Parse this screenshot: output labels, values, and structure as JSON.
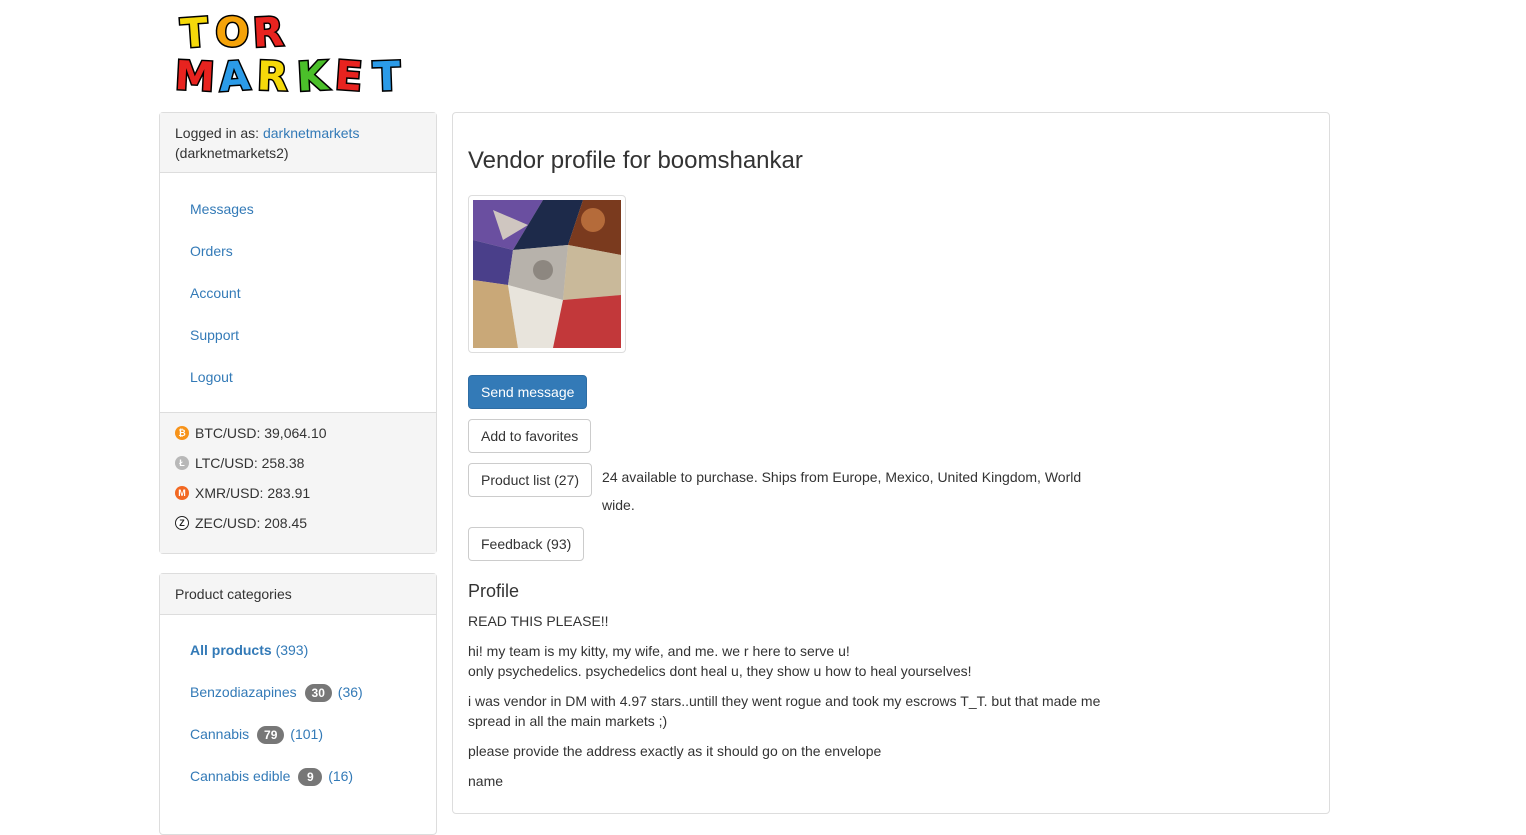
{
  "logo": {
    "line1": "TOR",
    "line2": "MARKET"
  },
  "user": {
    "logged_in_label": "Logged in as:",
    "username": "darknetmarkets",
    "alias": "(darknetmarkets2)"
  },
  "nav": [
    "Messages",
    "Orders",
    "Account",
    "Support",
    "Logout"
  ],
  "rates": [
    {
      "icon": "bitcoin-icon",
      "text": "BTC/USD: 39,064.10",
      "color": "#f7931a",
      "glyph": "₿"
    },
    {
      "icon": "litecoin-icon",
      "text": "LTC/USD: 258.38",
      "color": "#b8b8b8",
      "glyph": "Ł"
    },
    {
      "icon": "monero-icon",
      "text": "XMR/USD: 283.91",
      "color": "#f26822",
      "glyph": "M"
    },
    {
      "icon": "zcash-icon",
      "text": "ZEC/USD: 208.45",
      "color": "#222222",
      "glyph": "ⓩ"
    }
  ],
  "categories": {
    "title": "Product categories",
    "items": [
      {
        "label": "All products",
        "badge": "",
        "count": "(393)",
        "bold": true
      },
      {
        "label": "Benzodiazapines",
        "badge": "30",
        "count": "(36)",
        "bold": false
      },
      {
        "label": "Cannabis",
        "badge": "79",
        "count": "(101)",
        "bold": false
      },
      {
        "label": "Cannabis edible",
        "badge": "9",
        "count": "(16)",
        "bold": false
      }
    ]
  },
  "vendor": {
    "title": "Vendor profile for boomshankar",
    "send_message": "Send message",
    "add_favorites": "Add to favorites",
    "product_list": "Product list (27)",
    "availability": "24 available to purchase. Ships from Europe, Mexico, United Kingdom, World wide.",
    "feedback": "Feedback (93)",
    "profile_heading": "Profile",
    "profile_paragraphs": [
      "READ THIS PLEASE!!",
      "hi! my team is my kitty, my wife, and me. we r here to serve u!\nonly psychedelics. psychedelics dont heal u, they show u how to heal yourselves!",
      "i was vendor in DM with 4.97 stars..untill they went rogue and took my escrows T_T. but that made me spread in all the main markets ;)",
      "please provide the address exactly as it should go on the envelope",
      "name"
    ]
  },
  "colors": {
    "link": "#337ab7",
    "primary": "#337ab7",
    "panel_bg": "#f5f5f5",
    "badge": "#777777"
  }
}
